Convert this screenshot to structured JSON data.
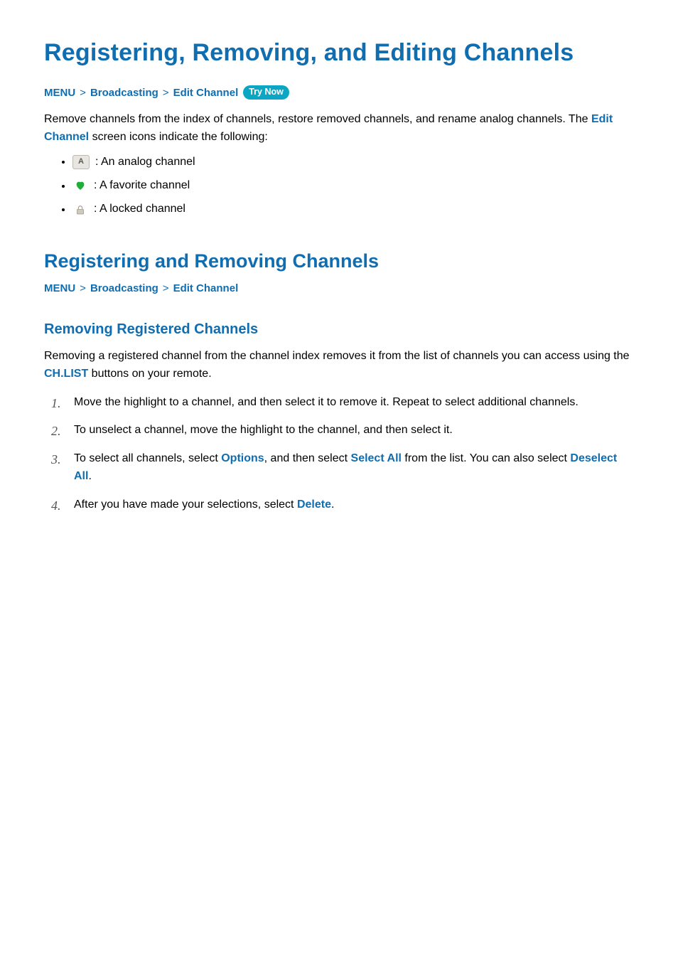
{
  "title": "Registering, Removing, and Editing Channels",
  "breadcrumb1": {
    "items": [
      "MENU",
      "Broadcasting",
      "Edit Channel"
    ],
    "pill": "Try Now"
  },
  "intro1": "Remove channels from the index of channels, restore removed channels, and rename analog channels. The ",
  "intro1_link": "Edit Channel",
  "intro1_tail": " screen icons indicate the following:",
  "legend": {
    "analog_letter": "A",
    "analog": " : An analog channel",
    "favorite": " : A favorite channel",
    "locked": " : A locked channel"
  },
  "h2": "Registering and Removing Channels",
  "breadcrumb2": {
    "items": [
      "MENU",
      "Broadcasting",
      "Edit Channel"
    ]
  },
  "h3": "Removing Registered Channels",
  "para2_a": "Removing a registered channel from the channel index removes it from the list of channels you can access using the ",
  "para2_link": "CH.LIST",
  "para2_b": " buttons on your remote.",
  "steps": {
    "s1": "Move the highlight to a channel, and then select it to remove it. Repeat to select additional channels.",
    "s2": "To unselect a channel, move the highlight to the channel, and then select it.",
    "s3_a": "To select all channels, select ",
    "s3_l1": "Options",
    "s3_b": ", and then select ",
    "s3_l2": "Select All",
    "s3_c": " from the list. You can also select ",
    "s3_l3": "Deselect All",
    "s3_d": ".",
    "s4_a": "After you have made your selections, select ",
    "s4_l1": "Delete",
    "s4_b": "."
  }
}
